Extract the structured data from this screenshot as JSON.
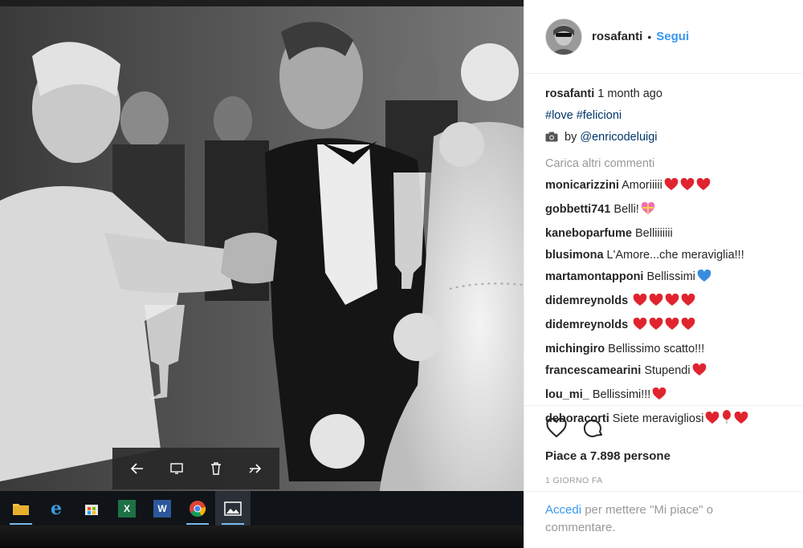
{
  "post": {
    "author": "rosafanti",
    "follow_label": "Segui",
    "separator": "•",
    "caption": {
      "username": "rosafanti",
      "time": "1 month ago",
      "hashtags": "#love #felicioni",
      "credit_prefix": "by",
      "credit_mention": "@enricodeluigi"
    },
    "load_more": "Carica altri commenti",
    "comments": [
      {
        "user": "monicarizzini",
        "text": "Amoriiiii",
        "emojis": [
          "heart",
          "heart",
          "heart"
        ]
      },
      {
        "user": "gobbetti741",
        "text": "Belli!",
        "emojis": [
          "gift-heart"
        ]
      },
      {
        "user": "kaneboparfume",
        "text": "Belliiiiiii",
        "emojis": []
      },
      {
        "user": "blusimona",
        "text": "L'Amore...che meraviglia!!!",
        "emojis": []
      },
      {
        "user": "martamontapponi",
        "text": "Bellissimi",
        "emojis": [
          "blue-heart"
        ]
      },
      {
        "user": "didemreynolds",
        "text": "",
        "emojis": [
          "heart",
          "heart",
          "heart",
          "heart"
        ]
      },
      {
        "user": "didemreynolds",
        "text": "",
        "emojis": [
          "heart",
          "heart",
          "heart",
          "heart"
        ]
      },
      {
        "user": "michingiro",
        "text": "Bellissimo scatto!!!",
        "emojis": []
      },
      {
        "user": "francescamearini",
        "text": "Stupendi",
        "emojis": [
          "heart"
        ]
      },
      {
        "user": "lou_mi_",
        "text": "Bellissimi!!!",
        "emojis": [
          "heart"
        ]
      },
      {
        "user": "deboracorti",
        "text": "Siete meravigliosi",
        "emojis": [
          "heart",
          "balloon",
          "heart"
        ]
      }
    ],
    "likes": "Piace a 7.898 persone",
    "posted_ago": "1 GIORNO FA",
    "login": {
      "link": "Accedi",
      "rest": " per mettere \"Mi piace\" o commentare."
    }
  },
  "viewer_toolbar": {
    "icons": [
      "back-arrow-icon",
      "slideshow-icon",
      "trash-icon",
      "share-icon"
    ]
  },
  "taskbar": {
    "apps": [
      "file-explorer-icon",
      "edge-icon",
      "store-icon",
      "excel-icon",
      "word-icon",
      "chrome-icon",
      "photos-icon"
    ],
    "active_app": "photos-icon"
  },
  "colors": {
    "link": "#3897f0",
    "hashtag": "#003569",
    "text": "#262626",
    "muted": "#999999",
    "heart_red": "#e0242f",
    "blue_heart": "#3a8dde"
  }
}
